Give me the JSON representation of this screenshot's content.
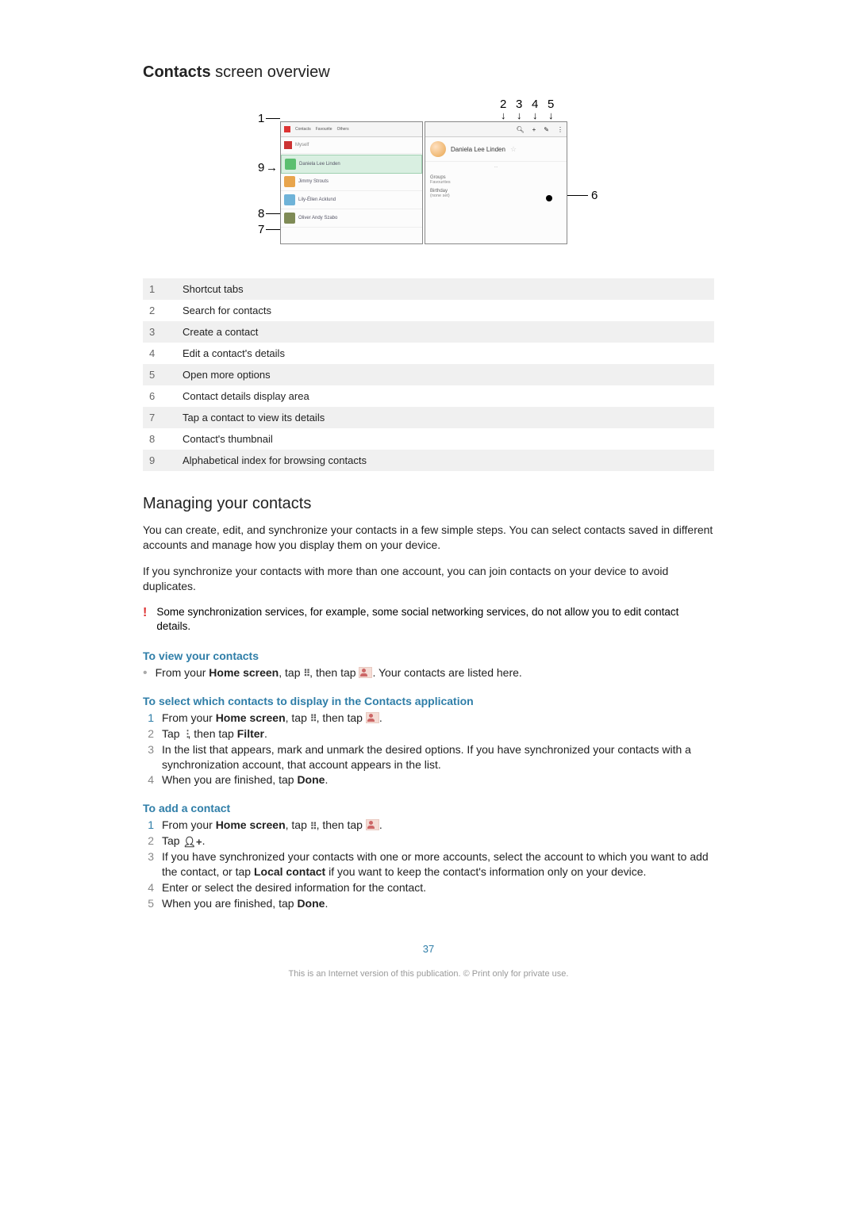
{
  "title_bold": "Contacts",
  "title_rest": " screen overview",
  "diagram": {
    "contact_name": "Daniela Lee Linden",
    "tabs": [
      "Contacts",
      "Favourite",
      "Others"
    ],
    "search_placeholder": "Myself",
    "rows": [
      "Daniela Lee Linden",
      "Jimmy Strouts",
      "Lily-Éllen Acklund",
      "Oliver Andy Szabo"
    ],
    "cards": {
      "label1": "Groups",
      "val1": "Favourites",
      "label2": "Birthday",
      "val2": "(none set)"
    },
    "callouts": {
      "top_left": "1",
      "top_right": [
        "2",
        "3",
        "4",
        "5"
      ],
      "left_mid": "9",
      "left_low1": "8",
      "left_low2": "7",
      "right": "6"
    }
  },
  "legend": [
    {
      "n": "1",
      "t": "Shortcut tabs"
    },
    {
      "n": "2",
      "t": "Search for contacts"
    },
    {
      "n": "3",
      "t": "Create a contact"
    },
    {
      "n": "4",
      "t": "Edit a contact's details"
    },
    {
      "n": "5",
      "t": "Open more options"
    },
    {
      "n": "6",
      "t": "Contact details display area"
    },
    {
      "n": "7",
      "t": "Tap a contact to view its details"
    },
    {
      "n": "8",
      "t": "Contact's thumbnail"
    },
    {
      "n": "9",
      "t": "Alphabetical index for browsing contacts"
    }
  ],
  "h2_manage": "Managing your contacts",
  "p1": "You can create, edit, and synchronize your contacts in a few simple steps. You can select contacts saved in different accounts and manage how you display them on your device.",
  "p2": "If you synchronize your contacts with more than one account, you can join contacts on your device to avoid duplicates.",
  "note": "Some synchronization services, for example, some social networking services, do not allow you to edit contact details.",
  "proc1_title": "To view your contacts",
  "proc1_bullet_pre": "From your ",
  "proc1_bullet_b1": "Home screen",
  "proc1_bullet_mid": ", tap ",
  "proc1_bullet_mid2": ", then tap ",
  "proc1_bullet_post": ". Your contacts are listed here.",
  "proc2_title": "To select which contacts to display in the Contacts application",
  "proc2": [
    {
      "n": "1",
      "pre": "From your ",
      "b1": "Home screen",
      "mid": ", tap ",
      "mid2": ", then tap ",
      "post": "."
    },
    {
      "n": "2",
      "pre": "Tap ",
      "mid": ", then tap ",
      "b2": "Filter",
      "post": "."
    },
    {
      "n": "3",
      "t": "In the list that appears, mark and unmark the desired options. If you have synchronized your contacts with a synchronization account, that account appears in the list."
    },
    {
      "n": "4",
      "pre": "When you are finished, tap ",
      "b1": "Done",
      "post": "."
    }
  ],
  "proc3_title": "To add a contact",
  "proc3": [
    {
      "n": "1",
      "pre": "From your ",
      "b1": "Home screen",
      "mid": ", tap ",
      "mid2": ", then tap ",
      "post": "."
    },
    {
      "n": "2",
      "pre": "Tap ",
      "post": "."
    },
    {
      "n": "3",
      "t": "If you have synchronized your contacts with one or more accounts, select the account to which you want to add the contact, or tap ",
      "b1": "Local contact",
      "t2": " if you want to keep the contact's information only on your device."
    },
    {
      "n": "4",
      "t": "Enter or select the desired information for the contact."
    },
    {
      "n": "5",
      "pre": "When you are finished, tap ",
      "b1": "Done",
      "post": "."
    }
  ],
  "pagenum": "37",
  "foot": "This is an Internet version of this publication. © Print only for private use."
}
